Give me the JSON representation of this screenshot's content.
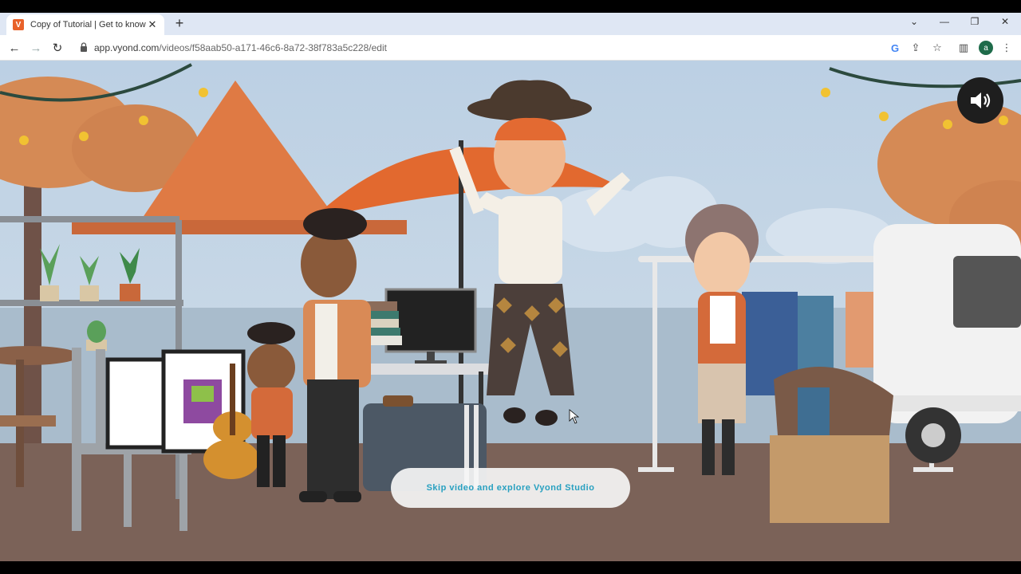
{
  "browser": {
    "tab": {
      "favicon_letter": "V",
      "title": "Copy of Tutorial | Get to know V",
      "close": "✕"
    },
    "new_tab": "+",
    "window_controls": {
      "dropdown": "⌄",
      "minimize": "—",
      "restore": "❐",
      "close": "✕"
    },
    "nav": {
      "back": "←",
      "forward": "→",
      "reload": "↻"
    },
    "url": {
      "host": "app.vyond.com",
      "path": "/videos/f58aab50-a171-46c6-8a72-38f783a5c228/edit"
    },
    "toolbar_icons": {
      "google": "G",
      "share": "⇪",
      "bookmark": "☆",
      "sidepanel": "▥",
      "menu": "⋮"
    },
    "profile_initial": "a"
  },
  "video": {
    "skip_label": "Skip video and explore Vyond Studio",
    "sound_icon": "speaker-icon"
  },
  "colors": {
    "accent": "#27a0c0",
    "umbrella": "#e2692f",
    "ground": "#7b6258",
    "tree": "#d58a55"
  }
}
